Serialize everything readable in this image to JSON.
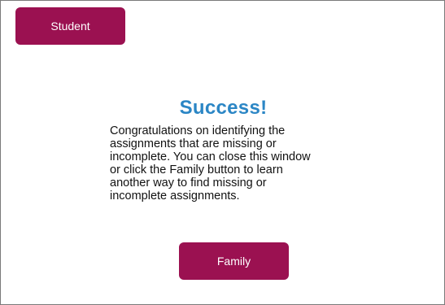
{
  "window": {
    "student_button_label": "Student",
    "family_button_label": "Family",
    "title": "Success!",
    "message": "Congratulations on identifying the\nassignments that are missing or\nincomplete.  You can close this window\nor click the Family button to learn\nanother way to find missing or\nincomplete assignments."
  },
  "colors": {
    "button_background": "#9b1151",
    "title_color": "#2b86c5"
  }
}
